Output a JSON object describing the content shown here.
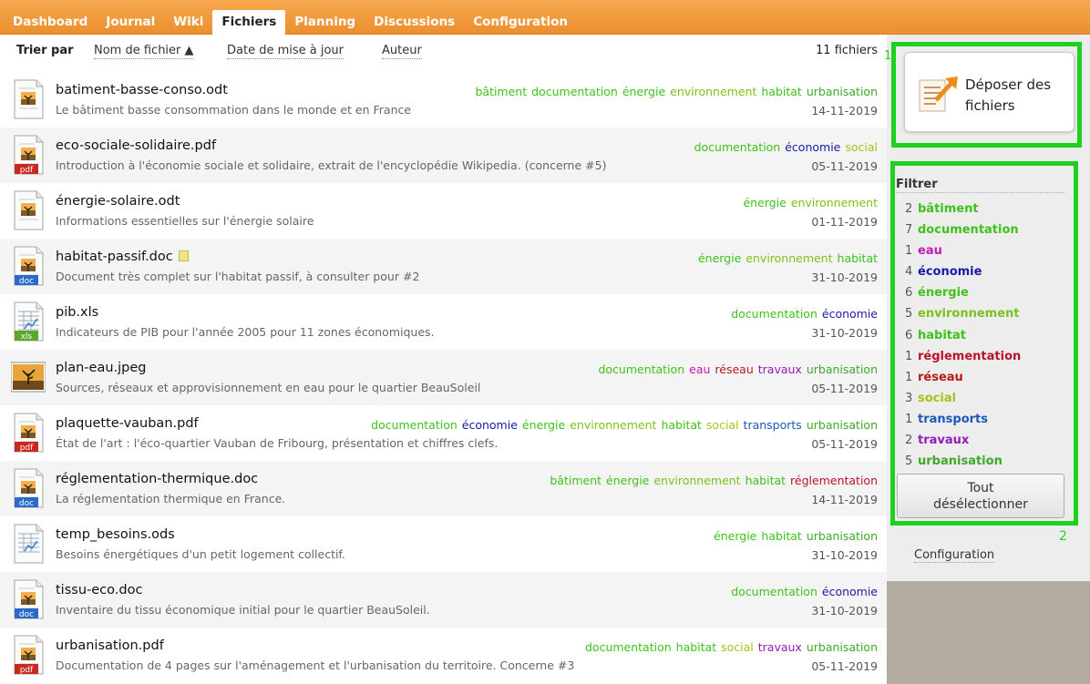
{
  "nav": {
    "tabs": [
      {
        "label": "Dashboard",
        "active": false
      },
      {
        "label": "Journal",
        "active": false
      },
      {
        "label": "Wiki",
        "active": false
      },
      {
        "label": "Fichiers",
        "active": true
      },
      {
        "label": "Planning",
        "active": false
      },
      {
        "label": "Discussions",
        "active": false
      },
      {
        "label": "Configuration",
        "active": false
      }
    ]
  },
  "sort": {
    "label": "Trier par",
    "by_name": "Nom de fichier ▲",
    "by_date": "Date de mise à jour",
    "by_author": "Auteur",
    "count": "11 fichiers"
  },
  "tag_colors": {
    "bâtiment": "#3ec21a",
    "documentation": "#3ec21a",
    "eau": "#c21ab4",
    "économie": "#1a1aa8",
    "énergie": "#3ec21a",
    "environnement": "#7ac21a",
    "habitat": "#3ec21a",
    "réglementation": "#b8142a",
    "réseau": "#b81a1a",
    "social": "#a8c21a",
    "transports": "#1a5ab8",
    "travaux": "#961ab8",
    "urbanisation": "#3ea82a"
  },
  "files": [
    {
      "name": "batiment-basse-conso.odt",
      "icon": "odt-file-icon",
      "note": false,
      "desc": "Le bâtiment basse consommation dans le monde et en France",
      "date": "14-11-2019",
      "tags": [
        "bâtiment",
        "documentation",
        "énergie",
        "environnement",
        "habitat",
        "urbanisation"
      ]
    },
    {
      "name": "eco-sociale-solidaire.pdf",
      "icon": "pdf-file-icon",
      "note": false,
      "desc": "Introduction à l'économie sociale et solidaire, extrait de l'encyclopédie Wikipedia. (concerne #5)",
      "date": "05-11-2019",
      "tags": [
        "documentation",
        "économie",
        "social"
      ]
    },
    {
      "name": "énergie-solaire.odt",
      "icon": "odt-file-icon",
      "note": false,
      "desc": "Informations essentielles sur l'énergie solaire",
      "date": "01-11-2019",
      "tags": [
        "énergie",
        "environnement"
      ]
    },
    {
      "name": "habitat-passif.doc",
      "icon": "doc-file-icon",
      "note": true,
      "desc": "Document très complet sur l'habitat passif, à consulter pour #2",
      "date": "31-10-2019",
      "tags": [
        "énergie",
        "environnement",
        "habitat"
      ]
    },
    {
      "name": "pib.xls",
      "icon": "xls-file-icon",
      "note": false,
      "desc": "Indicateurs de PIB pour l'année 2005 pour 11 zones économiques.",
      "date": "31-10-2019",
      "tags": [
        "documentation",
        "économie"
      ]
    },
    {
      "name": "plan-eau.jpeg",
      "icon": "image-thumbnail-icon",
      "note": false,
      "desc": "Sources, réseaux et approvisionnement en eau pour le quartier BeauSoleil",
      "date": "05-11-2019",
      "tags": [
        "documentation",
        "eau",
        "réseau",
        "travaux",
        "urbanisation"
      ]
    },
    {
      "name": "plaquette-vauban.pdf",
      "icon": "pdf-file-icon",
      "note": false,
      "desc": "État de l'art : l'éco-quartier Vauban de Fribourg, présentation et chiffres clefs.",
      "date": "05-11-2019",
      "tags": [
        "documentation",
        "économie",
        "énergie",
        "environnement",
        "habitat",
        "social",
        "transports",
        "urbanisation"
      ]
    },
    {
      "name": "réglementation-thermique.doc",
      "icon": "doc-file-icon",
      "note": false,
      "desc": "La réglementation thermique en France.",
      "date": "14-11-2019",
      "tags": [
        "bâtiment",
        "énergie",
        "environnement",
        "habitat",
        "réglementation"
      ]
    },
    {
      "name": "temp_besoins.ods",
      "icon": "ods-file-icon",
      "note": false,
      "desc": "Besoins énergétiques d'un petit logement collectif.",
      "date": "31-10-2019",
      "tags": [
        "énergie",
        "habitat",
        "urbanisation"
      ]
    },
    {
      "name": "tissu-eco.doc",
      "icon": "doc-file-icon",
      "note": false,
      "desc": "Inventaire du tissu économique initial pour le quartier BeauSoleil.",
      "date": "31-10-2019",
      "tags": [
        "documentation",
        "économie"
      ]
    },
    {
      "name": "urbanisation.pdf",
      "icon": "pdf-file-icon",
      "note": false,
      "desc": "Documentation de 4 pages sur l'aménagement et l'urbanisation du territoire. Concerne #3",
      "date": "05-11-2019",
      "tags": [
        "documentation",
        "habitat",
        "social",
        "travaux",
        "urbanisation"
      ]
    }
  ],
  "sidebar": {
    "upload_line1": "Déposer des",
    "upload_line2": "fichiers",
    "marker1": "1",
    "marker2": "2",
    "filter_title": "Filtrer",
    "filters": [
      {
        "count": "2",
        "tag": "bâtiment"
      },
      {
        "count": "7",
        "tag": "documentation"
      },
      {
        "count": "1",
        "tag": "eau"
      },
      {
        "count": "4",
        "tag": "économie"
      },
      {
        "count": "6",
        "tag": "énergie"
      },
      {
        "count": "5",
        "tag": "environnement"
      },
      {
        "count": "6",
        "tag": "habitat"
      },
      {
        "count": "1",
        "tag": "réglementation"
      },
      {
        "count": "1",
        "tag": "réseau"
      },
      {
        "count": "3",
        "tag": "social"
      },
      {
        "count": "1",
        "tag": "transports"
      },
      {
        "count": "2",
        "tag": "travaux"
      },
      {
        "count": "5",
        "tag": "urbanisation"
      }
    ],
    "deselect_line1": "Tout",
    "deselect_line2": "désélectionner",
    "config": "Configuration"
  }
}
